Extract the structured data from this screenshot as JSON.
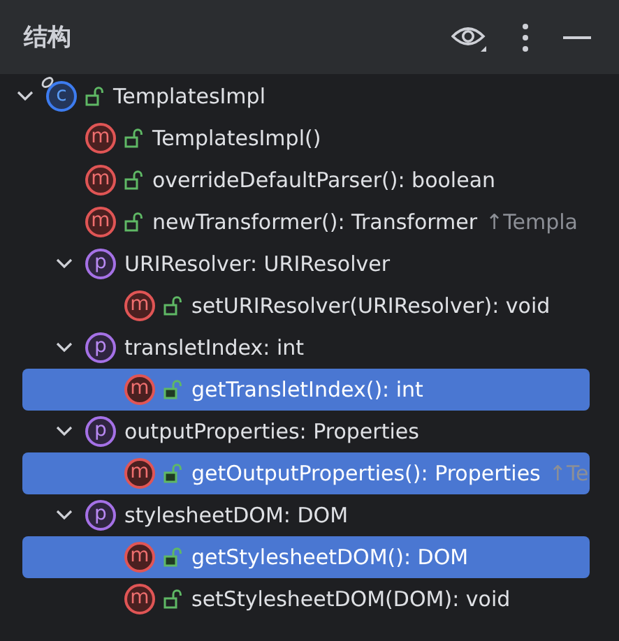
{
  "panel": {
    "title": "结构"
  },
  "tree": [
    {
      "kind": "class",
      "badge": "c",
      "public": true,
      "label": "TemplatesImpl",
      "selected": false,
      "expanded": true,
      "children": [
        {
          "kind": "method",
          "badge": "m",
          "public": true,
          "label": "TemplatesImpl()",
          "selected": false
        },
        {
          "kind": "method",
          "badge": "m",
          "public": true,
          "label": "overrideDefaultParser(): boolean",
          "selected": false
        },
        {
          "kind": "method",
          "badge": "m",
          "public": true,
          "label": "newTransformer(): Transformer",
          "inherited": "↑Templa",
          "selected": false
        },
        {
          "kind": "property",
          "badge": "p",
          "public": false,
          "label": "URIResolver: URIResolver",
          "selected": false,
          "expanded": true,
          "children": [
            {
              "kind": "method",
              "badge": "m",
              "public": true,
              "label": "setURIResolver(URIResolver): void",
              "selected": false
            }
          ]
        },
        {
          "kind": "property",
          "badge": "p",
          "public": false,
          "label": "transletIndex: int",
          "selected": false,
          "expanded": true,
          "children": [
            {
              "kind": "method",
              "badge": "m",
              "public": true,
              "label": "getTransletIndex(): int",
              "selected": true
            }
          ]
        },
        {
          "kind": "property",
          "badge": "p",
          "public": false,
          "label": "outputProperties: Properties",
          "selected": false,
          "expanded": true,
          "children": [
            {
              "kind": "method",
              "badge": "m",
              "public": true,
              "label": "getOutputProperties(): Properties",
              "inherited": "↑Te",
              "selected": true
            }
          ]
        },
        {
          "kind": "property",
          "badge": "p",
          "public": false,
          "label": "stylesheetDOM: DOM",
          "selected": false,
          "expanded": true,
          "children": [
            {
              "kind": "method",
              "badge": "m",
              "public": true,
              "label": "getStylesheetDOM(): DOM",
              "selected": true
            },
            {
              "kind": "method",
              "badge": "m",
              "public": true,
              "label": "setStylesheetDOM(DOM): void",
              "selected": false
            }
          ]
        }
      ]
    }
  ]
}
